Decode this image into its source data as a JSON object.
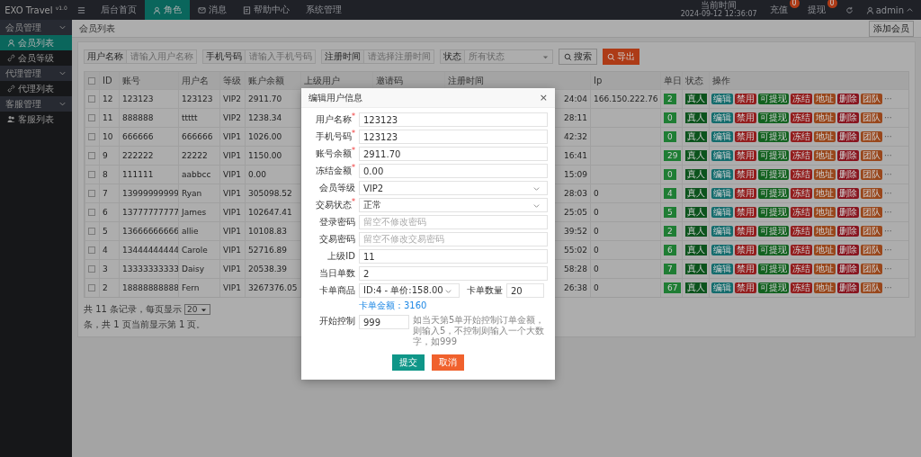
{
  "app": {
    "logo": "EXO Travel $^{v1.0}$"
  },
  "nav": [
    {
      "label": "后台首页",
      "selected": false
    },
    {
      "label": "角色",
      "selected": true
    },
    {
      "label": "消息",
      "selected": false
    },
    {
      "label": "帮助中心",
      "selected": false
    },
    {
      "label": "系统管理",
      "selected": false
    }
  ],
  "top_right": {
    "time_label": "当前时间",
    "time": "2024-09-12 12:36:07",
    "recharge": "充值",
    "recharge_badge": "0",
    "withdraw": "提现",
    "withdraw_badge": "0",
    "user": "admin"
  },
  "sidebar": [
    {
      "label": "会员管理",
      "expanded": true,
      "children": [
        {
          "label": "会员列表",
          "selected": true
        },
        {
          "label": "会员等级",
          "selected": false
        }
      ]
    },
    {
      "label": "代理管理",
      "expanded": true,
      "children": [
        {
          "label": "代理列表",
          "selected": false
        }
      ]
    },
    {
      "label": "客服管理",
      "expanded": true,
      "children": [
        {
          "label": "客服列表",
          "selected": false
        }
      ]
    }
  ],
  "breadcrumb": "会员列表",
  "add_button": "添加会员",
  "filters": [
    {
      "label": "用户名称",
      "placeholder": "请输入用户名称",
      "kind": "input"
    },
    {
      "label": "手机号码",
      "placeholder": "请输入手机号码",
      "kind": "input"
    },
    {
      "label": "注册时间",
      "placeholder": "请选择注册时间",
      "kind": "input"
    },
    {
      "label": "状态",
      "placeholder": "所有状态",
      "kind": "select"
    }
  ],
  "search_button": "搜索",
  "export_button": "导出",
  "table": {
    "header_checked": false,
    "columns": [
      "ID",
      "账号",
      "用户名",
      "等级",
      "账户余额",
      "上级用户",
      "邀请码",
      "注册时间",
      "Ip",
      "单日",
      "状态",
      "操作"
    ],
    "rows": [
      {
        "checked": false,
        "id": "12",
        "account": "123123",
        "username": "123123",
        "level": "VIP2",
        "balance": "2911.70",
        "time": "24:04",
        "ip": "166.150.222.76",
        "count": "2",
        "status": "真人",
        "more": "···",
        "actions": [
          {
            "label": "编辑",
            "color": "#146c6d"
          },
          {
            "label": "禁用",
            "color": "#931d1d"
          },
          {
            "label": "可提现",
            "color": "#12611f"
          },
          {
            "label": "冻结",
            "color": "#931d1d"
          },
          {
            "label": "地址",
            "color": "#98471c"
          },
          {
            "label": "删除",
            "color": "#88141e"
          },
          {
            "label": "团队",
            "color": "#98471c"
          }
        ]
      },
      {
        "checked": false,
        "id": "11",
        "account": "888888",
        "username": "ttttt",
        "level": "VIP2",
        "balance": "1238.34",
        "time": "28:11",
        "count": "0",
        "status": "真人",
        "more": "···",
        "actions": [
          {
            "label": "编辑",
            "color": "#146c6d"
          },
          {
            "label": "禁用",
            "color": "#931d1d"
          },
          {
            "label": "可提现",
            "color": "#12611f"
          },
          {
            "label": "冻结",
            "color": "#931d1d"
          },
          {
            "label": "地址",
            "color": "#98471c"
          },
          {
            "label": "删除",
            "color": "#88141e"
          },
          {
            "label": "团队",
            "color": "#98471c"
          }
        ]
      },
      {
        "checked": false,
        "id": "10",
        "account": "666666",
        "username": "666666",
        "level": "VIP1",
        "balance": "1026.00",
        "time": "42:32",
        "count": "0",
        "status": "真人",
        "more": "···",
        "actions": [
          {
            "label": "编辑",
            "color": "#146c6d"
          },
          {
            "label": "禁用",
            "color": "#931d1d"
          },
          {
            "label": "可提现",
            "color": "#12611f"
          },
          {
            "label": "冻结",
            "color": "#931d1d"
          },
          {
            "label": "地址",
            "color": "#98471c"
          },
          {
            "label": "删除",
            "color": "#88141e"
          },
          {
            "label": "团队",
            "color": "#98471c"
          }
        ]
      },
      {
        "checked": false,
        "id": "9",
        "account": "222222",
        "username": "22222",
        "level": "VIP1",
        "balance": "1150.00",
        "time": "16:41",
        "count": "29",
        "status": "真人",
        "more": "···",
        "actions": [
          {
            "label": "编辑",
            "color": "#146c6d"
          },
          {
            "label": "禁用",
            "color": "#931d1d"
          },
          {
            "label": "可提现",
            "color": "#12611f"
          },
          {
            "label": "冻结",
            "color": "#931d1d"
          },
          {
            "label": "地址",
            "color": "#98471c"
          },
          {
            "label": "删除",
            "color": "#88141e"
          },
          {
            "label": "团队",
            "color": "#98471c"
          }
        ]
      },
      {
        "checked": false,
        "id": "8",
        "account": "111111",
        "username": "aabbcc",
        "level": "VIP1",
        "balance": "0.00",
        "time": "15:09",
        "count": "0",
        "status": "真人",
        "more": "···",
        "actions": [
          {
            "label": "编辑",
            "color": "#146c6d"
          },
          {
            "label": "禁用",
            "color": "#931d1d"
          },
          {
            "label": "可提现",
            "color": "#12611f"
          },
          {
            "label": "冻结",
            "color": "#931d1d"
          },
          {
            "label": "地址",
            "color": "#98471c"
          },
          {
            "label": "删除",
            "color": "#88141e"
          },
          {
            "label": "团队",
            "color": "#98471c"
          }
        ]
      },
      {
        "checked": false,
        "id": "7",
        "account": "13999999999",
        "username": "Ryan",
        "level": "VIP1",
        "balance": "305098.52",
        "time": "28:03",
        "ip": "0",
        "count": "4",
        "status": "真人",
        "more": "···",
        "actions": [
          {
            "label": "编辑",
            "color": "#146c6d"
          },
          {
            "label": "禁用",
            "color": "#931d1d"
          },
          {
            "label": "可提现",
            "color": "#12611f"
          },
          {
            "label": "冻结",
            "color": "#931d1d"
          },
          {
            "label": "地址",
            "color": "#98471c"
          },
          {
            "label": "删除",
            "color": "#88141e"
          },
          {
            "label": "团队",
            "color": "#98471c"
          }
        ]
      },
      {
        "checked": false,
        "id": "6",
        "account": "13777777777",
        "username": "James",
        "level": "VIP1",
        "balance": "102647.41",
        "time": "25:05",
        "ip": "0",
        "count": "5",
        "status": "真人",
        "more": "···",
        "actions": [
          {
            "label": "编辑",
            "color": "#146c6d"
          },
          {
            "label": "禁用",
            "color": "#931d1d"
          },
          {
            "label": "可提现",
            "color": "#12611f"
          },
          {
            "label": "冻结",
            "color": "#931d1d"
          },
          {
            "label": "地址",
            "color": "#98471c"
          },
          {
            "label": "删除",
            "color": "#88141e"
          },
          {
            "label": "团队",
            "color": "#98471c"
          }
        ]
      },
      {
        "checked": false,
        "id": "5",
        "account": "13666666666",
        "username": "allie",
        "level": "VIP1",
        "balance": "10108.83",
        "time": "39:52",
        "ip": "0",
        "count": "2",
        "status": "真人",
        "more": "···",
        "actions": [
          {
            "label": "编辑",
            "color": "#146c6d"
          },
          {
            "label": "禁用",
            "color": "#931d1d"
          },
          {
            "label": "可提现",
            "color": "#12611f"
          },
          {
            "label": "冻结",
            "color": "#931d1d"
          },
          {
            "label": "地址",
            "color": "#98471c"
          },
          {
            "label": "删除",
            "color": "#88141e"
          },
          {
            "label": "团队",
            "color": "#98471c"
          }
        ]
      },
      {
        "checked": false,
        "id": "4",
        "account": "13444444444",
        "username": "Carole",
        "level": "VIP1",
        "balance": "52716.89",
        "time": "55:02",
        "ip": "0",
        "count": "6",
        "status": "真人",
        "more": "···",
        "actions": [
          {
            "label": "编辑",
            "color": "#146c6d"
          },
          {
            "label": "禁用",
            "color": "#931d1d"
          },
          {
            "label": "可提现",
            "color": "#12611f"
          },
          {
            "label": "冻结",
            "color": "#931d1d"
          },
          {
            "label": "地址",
            "color": "#98471c"
          },
          {
            "label": "删除",
            "color": "#88141e"
          },
          {
            "label": "团队",
            "color": "#98471c"
          }
        ]
      },
      {
        "checked": false,
        "id": "3",
        "account": "13333333333",
        "username": "Daisy",
        "level": "VIP1",
        "balance": "20538.39",
        "time": "58:28",
        "ip": "0",
        "count": "7",
        "status": "真人",
        "more": "···",
        "actions": [
          {
            "label": "编辑",
            "color": "#146c6d"
          },
          {
            "label": "禁用",
            "color": "#931d1d"
          },
          {
            "label": "可提现",
            "color": "#12611f"
          },
          {
            "label": "冻结",
            "color": "#931d1d"
          },
          {
            "label": "地址",
            "color": "#98471c"
          },
          {
            "label": "删除",
            "color": "#88141e"
          },
          {
            "label": "团队",
            "color": "#98471c"
          }
        ]
      },
      {
        "checked": false,
        "id": "2",
        "account": "18888888888",
        "username": "Fern",
        "level": "VIP1",
        "balance": "3267376.05",
        "time": "26:38",
        "ip": "0",
        "count": "67",
        "status": "真人",
        "more": "···",
        "actions": [
          {
            "label": "编辑",
            "color": "#146c6d"
          },
          {
            "label": "禁用",
            "color": "#931d1d"
          },
          {
            "label": "可提现",
            "color": "#12611f"
          },
          {
            "label": "冻结",
            "color": "#931d1d"
          },
          {
            "label": "地址",
            "color": "#98471c"
          },
          {
            "label": "删除",
            "color": "#88141e"
          },
          {
            "label": "团队",
            "color": "#98471c"
          }
        ]
      }
    ]
  },
  "pager": {
    "before": "共 11 条记录，每页显示",
    "size": "20",
    "after": "条，共 1 页当前显示第 1 页。"
  },
  "modal": {
    "title": "编辑用户信息",
    "close": "×",
    "fields": [
      {
        "label": "用户名称",
        "mark": "*",
        "kind": "input",
        "value": "123123"
      },
      {
        "label": "手机号码",
        "mark": "*",
        "kind": "input",
        "value": "123123"
      },
      {
        "label": "账号余额",
        "mark": "*",
        "kind": "input",
        "value": "2911.70"
      },
      {
        "label": "冻结金额",
        "mark": "*",
        "kind": "input",
        "value": "0.00"
      },
      {
        "label": "会员等级",
        "kind": "select",
        "value": "VIP2"
      },
      {
        "label": "交易状态",
        "mark": "*",
        "kind": "select",
        "value": "正常"
      },
      {
        "label": "登录密码",
        "kind": "input",
        "placeholder": "留空不修改密码"
      },
      {
        "label": "交易密码",
        "kind": "input",
        "placeholder": "留空不修改交易密码"
      },
      {
        "label": "上级ID",
        "kind": "input",
        "value": "11"
      },
      {
        "label": "当日单数",
        "kind": "input",
        "value": "2"
      }
    ],
    "card_row": {
      "goods_label": "卡单商品",
      "goods_value": "ID:4 - 单价:158.00",
      "qty_label": "卡单数量",
      "qty_value": "20",
      "amount_link": "卡单金额：3160"
    },
    "control_row": {
      "label": "开始控制",
      "value": "999",
      "hint": "如当天第5单开始控制订单金额，则输入5，不控制则输入一个大数字，如999"
    },
    "buttons": [
      {
        "label": "提交",
        "kind": "primary"
      },
      {
        "label": "取消",
        "kind": "cancel"
      }
    ]
  }
}
